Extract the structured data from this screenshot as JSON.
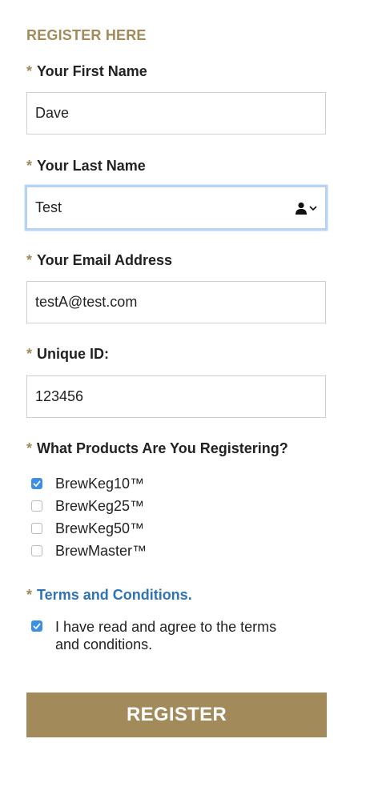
{
  "form": {
    "heading": "REGISTER HERE",
    "required_marker": "*",
    "first_name": {
      "label": "Your First Name",
      "value": "Dave"
    },
    "last_name": {
      "label": "Your Last Name",
      "value": "Test",
      "autofill_icon": "contact-autofill-icon"
    },
    "email": {
      "label": "Your Email Address",
      "value": "testA@test.com"
    },
    "unique_id": {
      "label": "Unique ID:",
      "value": "123456"
    },
    "products": {
      "label": "What Products Are You Registering?",
      "options": [
        {
          "label": "BrewKeg10™",
          "checked": true
        },
        {
          "label": "BrewKeg25™",
          "checked": false
        },
        {
          "label": "BrewKeg50™",
          "checked": false
        },
        {
          "label": "BrewMaster™",
          "checked": false
        }
      ]
    },
    "terms": {
      "link_label": "Terms and Conditions.",
      "agree_label": "I have read and agree to the terms and conditions.",
      "agree_checked": true
    },
    "submit_label": "REGISTER"
  },
  "colors": {
    "accent": "#a38a5a",
    "link": "#2f73b6",
    "checkbox_checked": "#3b8fe6",
    "focus_ring": "#b7d2f2"
  }
}
